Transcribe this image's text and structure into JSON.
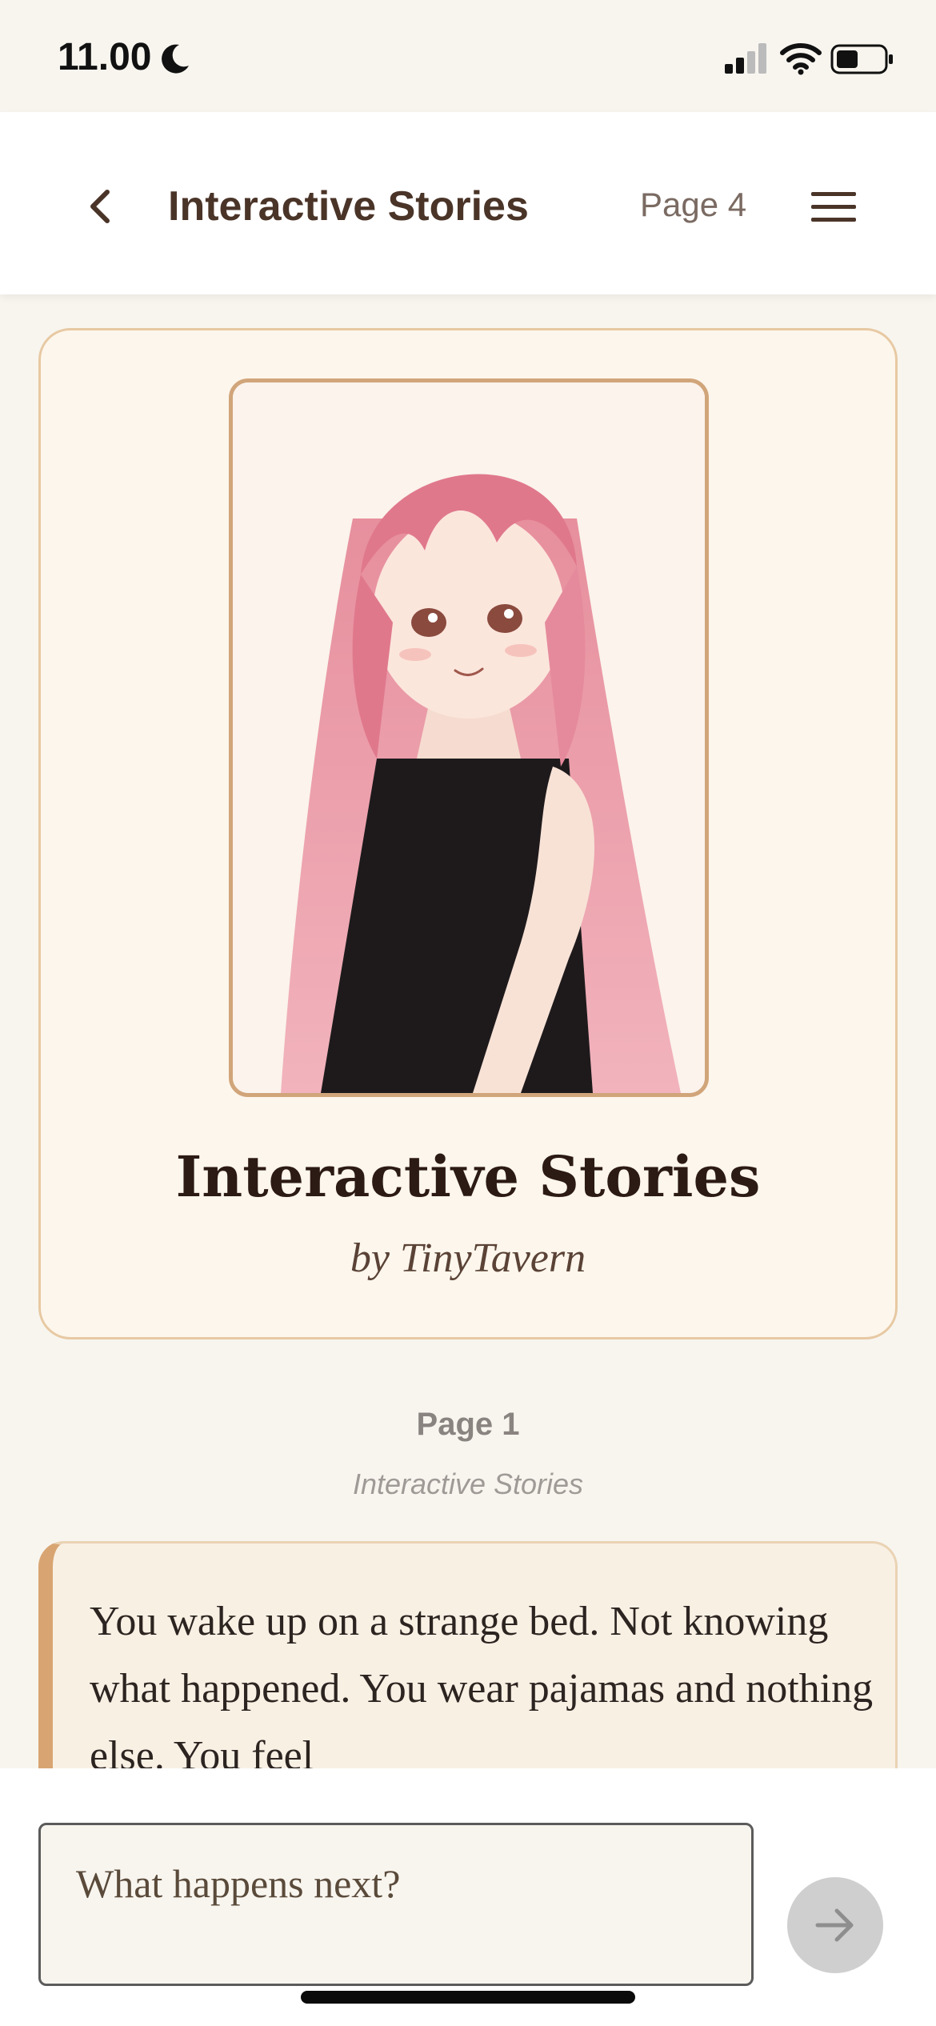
{
  "status_bar": {
    "time": "11.00",
    "icons": [
      "moon-icon",
      "signal-icon",
      "wifi-icon",
      "battery-icon"
    ]
  },
  "header": {
    "title": "Interactive Stories",
    "page_indicator": "Page 4",
    "icons": [
      "back-icon",
      "menu-icon"
    ]
  },
  "cover": {
    "title": "Interactive Stories",
    "author": "by TinyTavern",
    "art_icon": "anime-girl-illustration"
  },
  "page": {
    "label": "Page 1",
    "sublabel": "Interactive Stories"
  },
  "story": {
    "text": "You wake up on a strange bed. Not knowing what happened. You wear pajamas and nothing else. You feel"
  },
  "input": {
    "placeholder": "What happens next?",
    "send_icon": "arrow-right-icon"
  },
  "colors": {
    "background": "#f8f5ef",
    "card": "#fdf6ec",
    "accent": "#d8a572",
    "text_dark": "#4a3428",
    "send_button": "#cfcfcf"
  }
}
